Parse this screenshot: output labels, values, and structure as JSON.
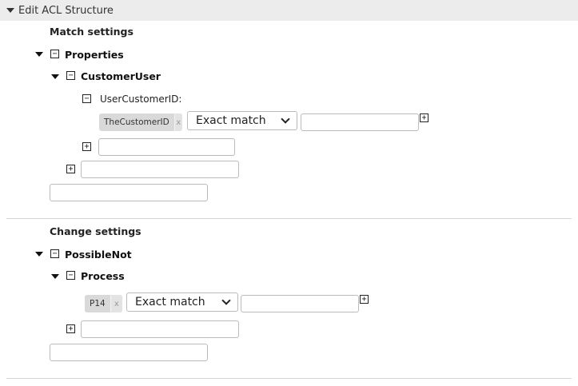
{
  "header": {
    "title": "Edit ACL Structure"
  },
  "match": {
    "title": "Match settings",
    "root_label": "Properties",
    "child_label": "CustomerUser",
    "field_label": "UserCustomerID:",
    "tag_value": "TheCustomerID",
    "tag_remove": "x",
    "select_value": "Exact match"
  },
  "change": {
    "title": "Change settings",
    "root_label": "PossibleNot",
    "child_label": "Process",
    "tag_value": "P14",
    "tag_remove": "x",
    "select_value": "Exact match"
  },
  "icons": {
    "collapse": "⊟",
    "expand": "⊞",
    "expand_triangle": "triangle-down"
  }
}
